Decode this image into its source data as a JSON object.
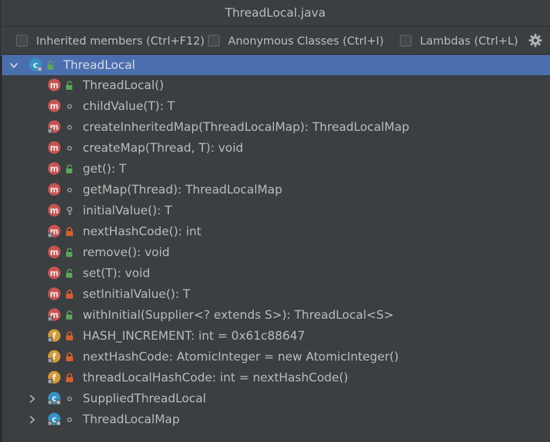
{
  "window": {
    "title": "ThreadLocal.java"
  },
  "toolbar": {
    "inherited_label": "Inherited members (Ctrl+F12)",
    "anonymous_label": "Anonymous Classes (Ctrl+I)",
    "lambdas_label": "Lambdas (Ctrl+L)",
    "settings_icon": "gear-icon"
  },
  "colors": {
    "selection": "#4b6eaf",
    "method_icon": "#c75450",
    "field_icon": "#d39a3a",
    "class_icon": "#3592c4",
    "public_lock": "#5aa55a",
    "private_lock": "#d6612d"
  },
  "tree": {
    "root": {
      "label": "ThreadLocal",
      "kind": "class",
      "visibility": "public",
      "expanded": true
    },
    "members": [
      {
        "label": "ThreadLocal()",
        "kind": "method",
        "visibility": "public",
        "override": false
      },
      {
        "label": "childValue(T): T",
        "kind": "method",
        "visibility": "package",
        "override": false
      },
      {
        "label": "createInheritedMap(ThreadLocalMap): ThreadLocalMap",
        "kind": "method",
        "visibility": "package",
        "override": true
      },
      {
        "label": "createMap(Thread, T): void",
        "kind": "method",
        "visibility": "package",
        "override": false
      },
      {
        "label": "get(): T",
        "kind": "method",
        "visibility": "public",
        "override": false
      },
      {
        "label": "getMap(Thread): ThreadLocalMap",
        "kind": "method",
        "visibility": "package",
        "override": false
      },
      {
        "label": "initialValue(): T",
        "kind": "method",
        "visibility": "protected",
        "override": false
      },
      {
        "label": "nextHashCode(): int",
        "kind": "method",
        "visibility": "private",
        "override": true
      },
      {
        "label": "remove(): void",
        "kind": "method",
        "visibility": "public",
        "override": false
      },
      {
        "label": "set(T): void",
        "kind": "method",
        "visibility": "public",
        "override": false
      },
      {
        "label": "setInitialValue(): T",
        "kind": "method",
        "visibility": "private",
        "override": false
      },
      {
        "label": "withInitial(Supplier<? extends S>): ThreadLocal<S>",
        "kind": "method",
        "visibility": "public",
        "override": true
      },
      {
        "label": "HASH_INCREMENT: int = 0x61c88647",
        "kind": "field",
        "visibility": "private",
        "override": true
      },
      {
        "label": "nextHashCode: AtomicInteger = new AtomicInteger()",
        "kind": "field",
        "visibility": "private",
        "override": true
      },
      {
        "label": "threadLocalHashCode: int = nextHashCode()",
        "kind": "field",
        "visibility": "private",
        "override": true
      },
      {
        "label": "SuppliedThreadLocal",
        "kind": "class",
        "visibility": "package",
        "override": true,
        "expandable": true
      },
      {
        "label": "ThreadLocalMap",
        "kind": "class",
        "visibility": "package",
        "override": true,
        "expandable": true
      }
    ]
  }
}
